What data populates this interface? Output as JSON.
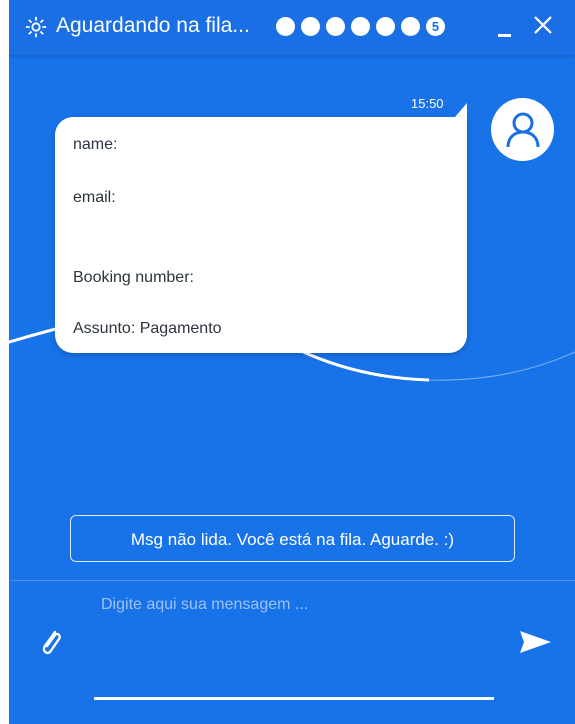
{
  "header": {
    "title": "Aguardando na fila...",
    "queue_position": "5",
    "icons": {
      "settings": "gear-icon",
      "minimize": "minimize-icon",
      "close": "close-icon"
    }
  },
  "message": {
    "time": "15:50",
    "lines": [
      "name:",
      "email:",
      "Booking number:",
      "Assunto: Pagamento"
    ]
  },
  "status_text": "Msg não lida. Você está na fila. Aguarde. :)",
  "composer": {
    "placeholder": "Digite aqui sua mensagem ...",
    "icons": {
      "attach": "paperclip-icon",
      "send": "send-icon"
    }
  },
  "colors": {
    "background": "#1872e8",
    "bubble": "#ffffff",
    "text": "#2b3440"
  }
}
